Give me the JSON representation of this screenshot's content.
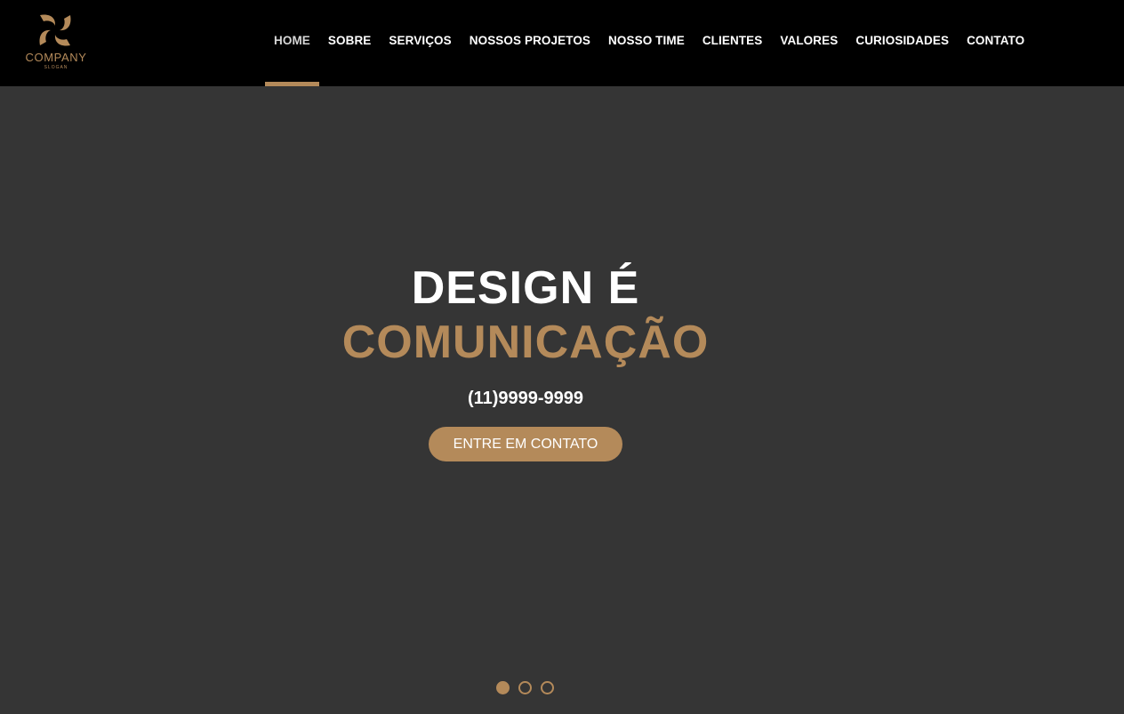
{
  "brand": {
    "name": "COMPANY",
    "slogan": "SLOGAN",
    "accent_color": "#b48a5a",
    "logo_icon": "swirl-logo-icon"
  },
  "nav": {
    "items": [
      {
        "label": "HOME",
        "active": true
      },
      {
        "label": "SOBRE",
        "active": false
      },
      {
        "label": "SERVIÇOS",
        "active": false
      },
      {
        "label": "NOSSOS PROJETOS",
        "active": false
      },
      {
        "label": "NOSSO TIME",
        "active": false
      },
      {
        "label": "CLIENTES",
        "active": false
      },
      {
        "label": "VALORES",
        "active": false
      },
      {
        "label": "CURIOSIDADES",
        "active": false
      },
      {
        "label": "CONTATO",
        "active": false
      }
    ]
  },
  "hero": {
    "title_line1": "DESIGN É",
    "title_line2": "COMUNICAÇÃO",
    "phone": "(11)9999-9999",
    "cta_label": "ENTRE EM CONTATO",
    "slides_total": 3,
    "active_slide": 1
  },
  "colors": {
    "header_bg": "#000000",
    "hero_bg": "#353535",
    "accent": "#b48a5a",
    "text": "#ffffff"
  }
}
